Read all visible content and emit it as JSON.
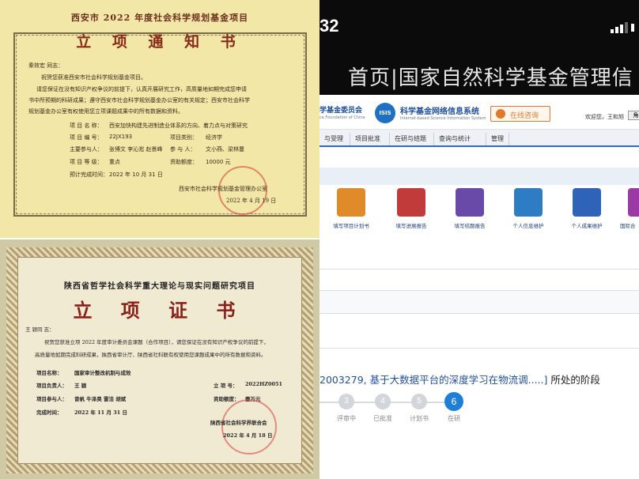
{
  "cert1": {
    "title": "西安市 2022 年度社会科学规划基金项目",
    "heading": "立 项 通 知 书",
    "greeting": "秦效宏 同志：",
    "para1": "祝贺您获准西安市社会科学规划基金项目。",
    "para2": "请您保证在没有知识产权争议的前提下，认真开展研究工作，高质量地如期完成您申请",
    "para3": "书中所预期的科研成果；遵守西安市社会科学规划基金办公室的有关规定；西安市社会科学",
    "para4": "规划基金办公室有权使用您立项课题成果中的所有数据和资料。",
    "name_label": "项 目 名 称：",
    "name_value": "西安加快构建先进制造业体系的方向、着力点与对策研究",
    "code_label": "项 目 编 号：",
    "code_value": "22JX193",
    "category_label": "项目类别：",
    "category_value": "经济学",
    "members_label": "主要参与人：",
    "members_value": "张博文  李沁淞    赵景峰",
    "participants_label": "参 与 人：",
    "participants_value": "文小燕、梁林蔓",
    "level_label": "项 目 等 级：",
    "level_value": "重点",
    "funding_label": "资助额度：",
    "funding_value": "10000 元",
    "deadline_label": "预计完成时间：",
    "deadline_value": "2022 年 10 月 31 日",
    "issuer": "西安市社会科学规划基金管理办公室",
    "date": "2022 年 4 月 19 日"
  },
  "cert2": {
    "title": "陕西省哲学社会科学重大理论与现实问题研究项目",
    "heading": "立 项 证 书",
    "greeting": "王  颖同 志：",
    "para1": "祝贺您获准立项 2022 年度审计委员会课题（合作项目），请您保证在没有知识产权争议的前提下，",
    "para2": "高质量地如期完成科研成果，陕西省审计厅、陕西省社科联有权使用您课题成果中的所有数据和资料。",
    "name_label": "项目名称：",
    "name_value": "国家审计整改机制与成效",
    "leader_label": "项目负责人：",
    "leader_value": "王  颖",
    "number_label": "立 项 号：",
    "number_value": "2022HZ0051",
    "members_label": "项目参与人：",
    "members_value": "曾帆 牛泽昊 雷洁 胡斌",
    "funding_label": "资助额度：",
    "funding_value": "壹万元",
    "deadline_label": "完成时间：",
    "deadline_value": "2022 年 11 月 31 日",
    "issuer": "陕西省社会科学界联合会",
    "date": "2022 年 4 月 18 日"
  },
  "phone": {
    "time": "32",
    "page_title": "首页|国家自然科学基金管理信",
    "org_name": "学基金委员会",
    "org_sub": "ce Foundation of China",
    "isis_logo": "ISIS",
    "system_name": "科学基金网络信息系统",
    "system_sub": "Internet-based Science Information System",
    "consult_label": "在线咨询",
    "welcome": "欢迎您，王和旭",
    "home_label": "角",
    "nav": [
      "与受理",
      "项目批准",
      "在研与结题",
      "查询与统计",
      "管理"
    ],
    "tiles": [
      {
        "label": "填写项目计划书",
        "icon": "plan-document-icon",
        "color": "#e08b2a"
      },
      {
        "label": "填写进展报告",
        "icon": "progress-report-icon",
        "color": "#c23b3b"
      },
      {
        "label": "填写结题报告",
        "icon": "final-report-icon",
        "color": "#6a4aa8"
      },
      {
        "label": "个人信息维护",
        "icon": "person-icon",
        "color": "#2e7dc4"
      },
      {
        "label": "个人成果维护",
        "icon": "achievement-edit-icon",
        "color": "#2e63b8"
      },
      {
        "label": "国际合",
        "icon": "international-icon",
        "color": "#9b3aa6"
      }
    ],
    "project_id": "2003279, 基于大数据平台的深度学习在物流调.....]",
    "project_suffix": " 所处的阶段",
    "steps": [
      {
        "num": "3",
        "label": "评审中"
      },
      {
        "num": "4",
        "label": "已批准"
      },
      {
        "num": "5",
        "label": "计划书"
      },
      {
        "num": "6",
        "label": "在研"
      }
    ],
    "active_color": "#1f7fd6",
    "link_color": "#1f4f9e"
  }
}
